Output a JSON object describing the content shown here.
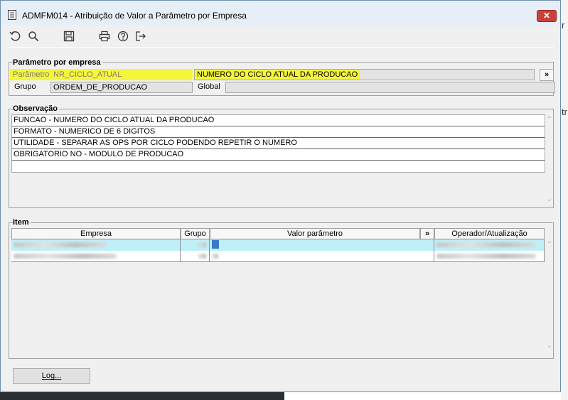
{
  "window": {
    "title": "ADMFM014 - Atribuição de Valor a Parâmetro por Empresa",
    "close_label": "✕"
  },
  "toolbar": {
    "icons": [
      "undo-icon",
      "search-icon",
      "save-icon",
      "print-icon",
      "help-icon",
      "exit-icon"
    ]
  },
  "parametro_group": {
    "title": "Parâmetro por empresa",
    "parametro_label": "Parâmetro",
    "parametro_value": "NR_CICLO_ATUAL",
    "parametro_desc": "NUMERO DO CICLO ATUAL DA PRODUCAO",
    "lookup_label": "»",
    "grupo_label": "Grupo",
    "grupo_value": "ORDEM_DE_PRODUCAO",
    "global_label": "Global"
  },
  "observacao_group": {
    "title": "Observação",
    "lines": [
      "FUNCAO - NUMERO DO CICLO ATUAL DA PRODUCAO",
      "FORMATO - NUMERICO DE 6 DIGITOS",
      "UTILIDADE - SEPARAR AS OPS POR CICLO PODENDO REPETIR O NUMERO",
      "OBRIGATORIO NO - MODULO DE PRODUCAO",
      ""
    ]
  },
  "item_group": {
    "title": "Item",
    "columns": {
      "empresa": "Empresa",
      "grupo": "Grupo",
      "valor": "Valor parâmetro",
      "expand": "»",
      "operador": "Operador/Atualização"
    }
  },
  "log_button": "Log...",
  "background": {
    "frag1": "r",
    "frag2": "tr"
  },
  "colors": {
    "highlight": "#f5f53a",
    "selected_row": "#bff0f8",
    "title_bar": "#e6eef7",
    "close_button": "#c9423a"
  }
}
